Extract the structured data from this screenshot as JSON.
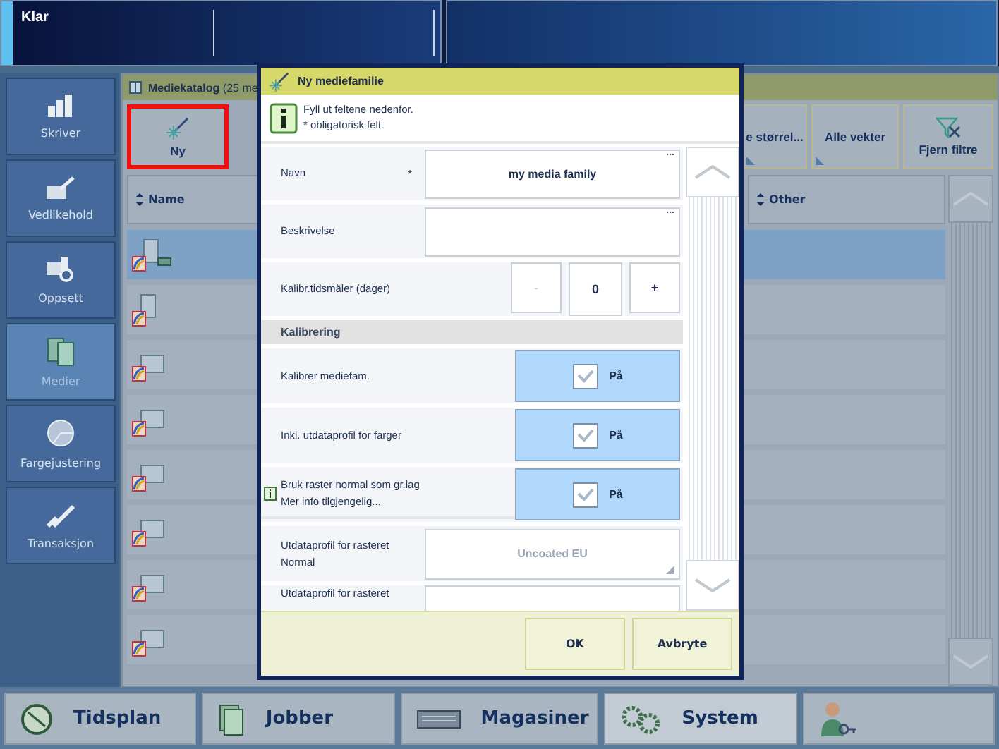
{
  "status_bar": {
    "status": "Klar"
  },
  "sidebar": {
    "items": [
      {
        "label": "Skriver",
        "selected": false
      },
      {
        "label": "Vedlikehold",
        "selected": false
      },
      {
        "label": "Oppsett",
        "selected": false
      },
      {
        "label": "Medier",
        "selected": true
      },
      {
        "label": "Fargejustering",
        "selected": false
      },
      {
        "label": "Transaksjon",
        "selected": false
      }
    ]
  },
  "catalog": {
    "title": "**Mediekatalog** (25 me",
    "toolbar": [
      {
        "kind": "new",
        "label": "Ny",
        "selected": true
      },
      {
        "kind": "menu",
        "label": "e størrel...",
        "selected": false
      },
      {
        "kind": "menu",
        "label": "Alle vekter",
        "selected": false
      },
      {
        "kind": "filter",
        "label": "Fjern filtre",
        "selected": false
      }
    ],
    "table": {
      "columns": [
        "Name",
        "Other"
      ],
      "rows": [
        {
          "selected": true
        },
        {
          "selected": false
        },
        {
          "selected": false
        },
        {
          "selected": false
        },
        {
          "selected": false
        },
        {
          "selected": false
        },
        {
          "selected": false
        },
        {
          "selected": false
        }
      ]
    }
  },
  "dialog": {
    "title": "Ny mediefamilie",
    "info": [
      "Fyll ut feltene nedenfor.",
      "* obligatorisk felt."
    ],
    "fields": [
      {
        "kind": "text",
        "label": "Navn",
        "required_mark": "*",
        "value": "my media family",
        "ellipsis": "..."
      },
      {
        "kind": "text",
        "label": "Beskrivelse",
        "ellipsis": "..."
      },
      {
        "kind": "stepper",
        "label": "Kalibr.tidsmåler (dager)",
        "value": "0",
        "buttons": [
          {
            "label": "-",
            "disabled": true
          },
          {
            "label": "+",
            "disabled": false
          }
        ]
      },
      {
        "kind": "section",
        "label": "Kalibrering"
      },
      {
        "kind": "toggle",
        "label": "Kalibrer mediefam.",
        "checked": true,
        "value": "På"
      },
      {
        "kind": "toggle",
        "label": "Inkl. utdataprofil for farger",
        "checked": true,
        "value": "På"
      },
      {
        "kind": "toggle",
        "label": "Bruk raster normal som gr.lag",
        "note": "Mer info tilgjengelig...",
        "info": true,
        "checked": true,
        "value": "På"
      },
      {
        "kind": "dropdown",
        "label": "Utdataprofil for rasteret Normal",
        "value": "Uncoated EU",
        "disabled": true
      },
      {
        "kind": "dropdown",
        "label": "Utdataprofil for rasteret"
      }
    ],
    "buttons": [
      "OK",
      "Avbryte"
    ]
  },
  "bottom_tabs": [
    {
      "label": "Tidsplan",
      "selected": false
    },
    {
      "label": "Jobber",
      "selected": false
    },
    {
      "label": "Magasiner",
      "selected": false
    },
    {
      "label": "System",
      "selected": true
    },
    {
      "kind": "user",
      "selected": false
    }
  ]
}
